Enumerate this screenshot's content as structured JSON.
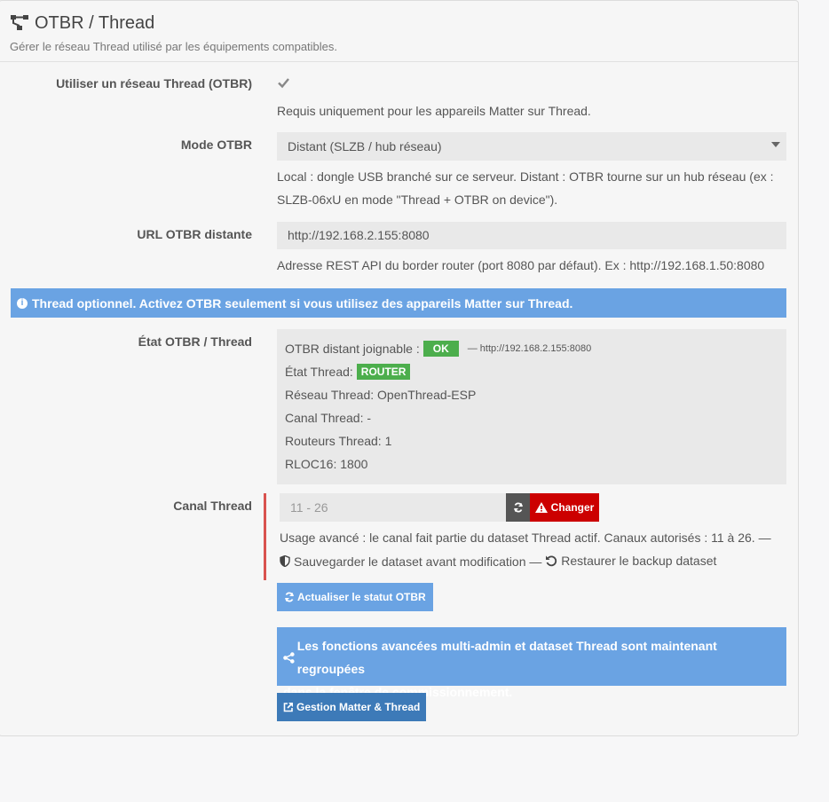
{
  "header": {
    "title": "OTBR / Thread",
    "subtitle": "Gérer le réseau Thread utilisé par les équipements compatibles.",
    "icon": "sitemap-icon"
  },
  "use_thread": {
    "label": "Utiliser un réseau Thread (OTBR)",
    "checked": true,
    "help": "Requis uniquement pour les appareils Matter sur Thread."
  },
  "mode": {
    "label": "Mode OTBR",
    "selected": "Distant (SLZB / hub réseau)",
    "help_line1": "Local : dongle USB branché sur ce serveur. Distant : OTBR tourne sur un hub réseau (ex :",
    "help_line2": "SLZB-06xU en mode \"Thread + OTBR on device\")."
  },
  "url": {
    "label": "URL OTBR distante",
    "value": "http://192.168.2.155:8080",
    "help": "Adresse REST API du border router (port 8080 par défaut). Ex : http://192.168.1.50:8080"
  },
  "info_alert": {
    "text": "Thread optionnel. Activez OTBR seulement si vous utilisez des appareils Matter sur Thread."
  },
  "status": {
    "label": "État OTBR / Thread",
    "reachable_label": "OTBR distant joignable :",
    "reachable_badge": "OK",
    "reachable_url": "— http://192.168.2.155:8080",
    "state_label": "État Thread:",
    "state_badge": "ROUTER",
    "network": "Réseau Thread: OpenThread-ESP",
    "channel": "Canal Thread: -",
    "routers": "Routeurs Thread: 1",
    "rloc16": "RLOC16: 1800"
  },
  "canal": {
    "label": "Canal Thread",
    "placeholder": "11 - 26",
    "change_button": "Changer",
    "help_text": "Usage avancé : le canal fait partie du dataset Thread actif. Canaux autorisés : 11 à 26. —",
    "save_link": "Sauvegarder le dataset avant modification —",
    "restore_link": "Restaurer le backup dataset"
  },
  "refresh_button": "Actualiser le statut OTBR",
  "advanced_alert": {
    "line1": "Les fonctions avancées multi-admin et dataset Thread sont maintenant regroupées",
    "line2": "dans la fenêtre de commissionnement."
  },
  "manage_button": "Gestion Matter & Thread",
  "colors": {
    "info": "#6aa3e3",
    "success": "#4cae4c",
    "danger": "#cc0000",
    "primary_dark": "#3d7ab8"
  }
}
